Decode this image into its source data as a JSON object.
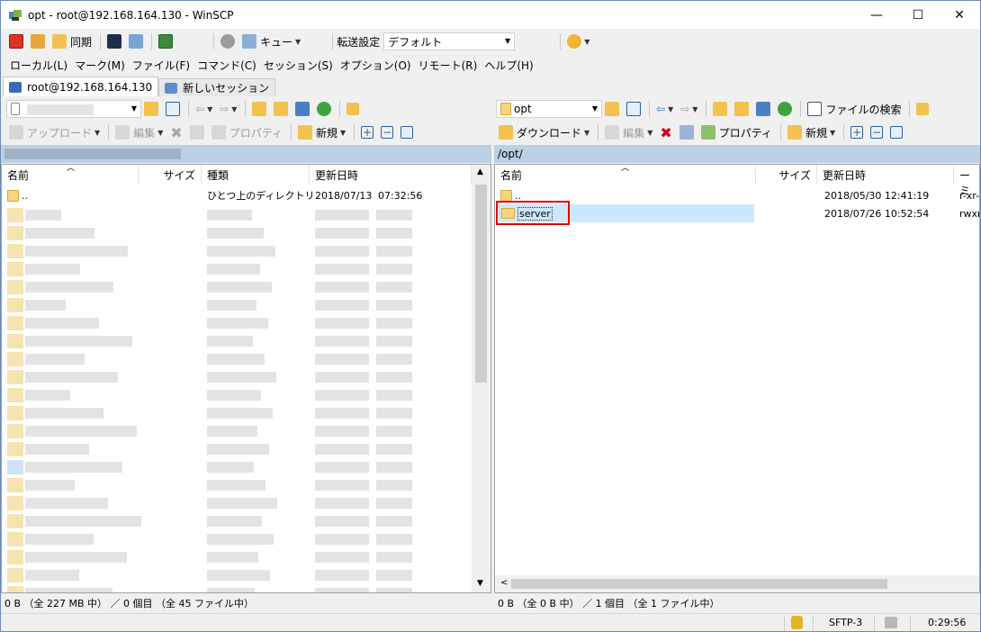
{
  "window": {
    "title": "opt - root@192.168.164.130 - WinSCP",
    "min": "—",
    "max": "☐",
    "close": "✕"
  },
  "toolbar1": {
    "sync_label": "同期",
    "queue_label": "キュー",
    "transfer_label": "転送設定",
    "transfer_value": "デフォルト"
  },
  "menu": [
    "ローカル(L)",
    "マーク(M)",
    "ファイル(F)",
    "コマンド(C)",
    "セッション(S)",
    "オプション(O)",
    "リモート(R)",
    "ヘルプ(H)"
  ],
  "tabs": {
    "active": "root@192.168.164.130",
    "new": "新しいセッション"
  },
  "left": {
    "upload": "アップロード",
    "edit": "編集",
    "props": "プロパティ",
    "new": "新規",
    "headers": {
      "name": "名前",
      "size": "サイズ",
      "type": "種類",
      "modified": "更新日時"
    },
    "parent": {
      "name": "..",
      "type": "ひとつ上のディレクトリ",
      "modified": "2018/07/13",
      "time": "07:32:56"
    },
    "status": "0 B （全 227 MB 中） ／ 0 個目 （全 45 ファイル中）"
  },
  "right": {
    "path_combo": "opt",
    "search": "ファイルの検索",
    "download": "ダウンロード",
    "edit": "編集",
    "props": "プロパティ",
    "new": "新規",
    "path": "/opt/",
    "headers": {
      "name": "名前",
      "size": "サイズ",
      "modified": "更新日時",
      "perm": "パーミ"
    },
    "rows": [
      {
        "name": "..",
        "modified": "2018/05/30 12:41:19",
        "perm": "r-xr-"
      },
      {
        "name": "server",
        "modified": "2018/07/26 10:52:54",
        "perm": "rwxr"
      }
    ],
    "status": "0 B （全 0 B 中） ／ 1 個目 （全 1 ファイル中）"
  },
  "statusbar": {
    "protocol": "SFTP-3",
    "time": "0:29:56"
  },
  "colors": {
    "accent": "#1e6fd9",
    "highlight": "#e00000",
    "selected": "#cce8ff",
    "pathbar": "#bcd0e4"
  }
}
